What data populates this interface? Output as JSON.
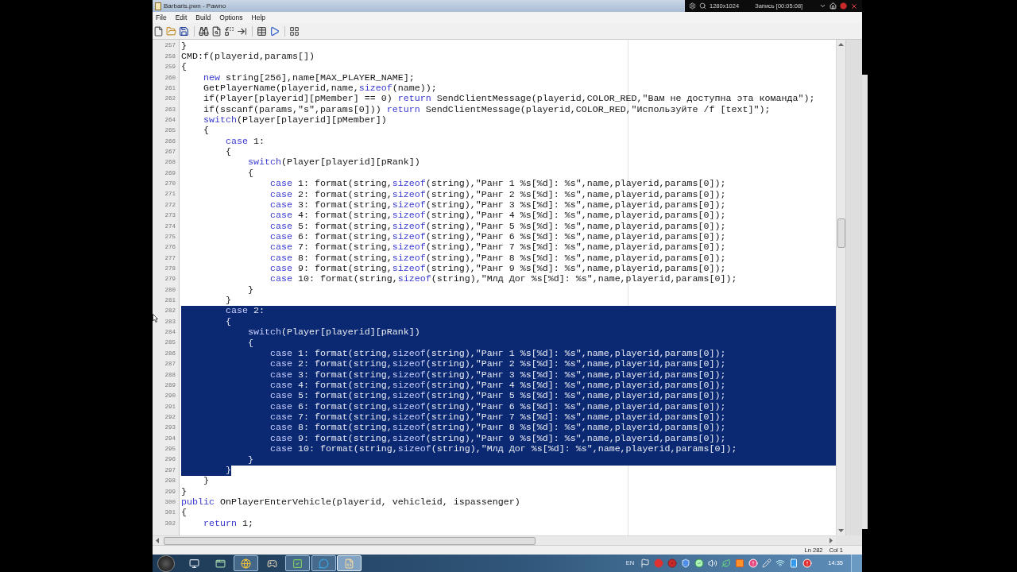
{
  "window": {
    "title": "Barbaris.pwn - Pawno"
  },
  "recorder_overlay": {
    "resolution": "1280x1024",
    "status": "Запись [00:05:08]"
  },
  "menu": [
    "File",
    "Edit",
    "Build",
    "Options",
    "Help"
  ],
  "editor": {
    "lines": [
      {
        "number": "257",
        "selected": false,
        "segments": [
          {
            "text": "}",
            "kind": "plain"
          }
        ]
      },
      {
        "number": "258",
        "selected": false,
        "segments": [
          {
            "text": "CMD:f(playerid,params[])",
            "kind": "plain"
          }
        ]
      },
      {
        "number": "259",
        "selected": false,
        "segments": [
          {
            "text": "{",
            "kind": "plain"
          }
        ]
      },
      {
        "number": "260",
        "selected": false,
        "segments": [
          {
            "text": "    new",
            "kind": "keyword"
          },
          {
            "text": " string[256],name[MAX_PLAYER_NAME];",
            "kind": "plain"
          }
        ]
      },
      {
        "number": "261",
        "selected": false,
        "segments": [
          {
            "text": "    GetPlayerName(playerid,name,",
            "kind": "plain"
          },
          {
            "text": "sizeof",
            "kind": "keyword"
          },
          {
            "text": "(name));",
            "kind": "plain"
          }
        ]
      },
      {
        "number": "262",
        "selected": false,
        "segments": [
          {
            "text": "    if(Player[playerid][pMember] == 0) ",
            "kind": "plain"
          },
          {
            "text": "return",
            "kind": "keyword"
          },
          {
            "text": " SendClientMessage(playerid,COLOR_RED,\"Вам не доступна эта команда\");",
            "kind": "plain"
          }
        ]
      },
      {
        "number": "263",
        "selected": false,
        "segments": [
          {
            "text": "    if(sscanf(params,\"s\",params[0])) ",
            "kind": "plain"
          },
          {
            "text": "return",
            "kind": "keyword"
          },
          {
            "text": " SendClientMessage(playerid,COLOR_RED,\"Используйте /f [text]\");",
            "kind": "plain"
          }
        ]
      },
      {
        "number": "264",
        "selected": false,
        "segments": [
          {
            "text": "    switch",
            "kind": "keyword"
          },
          {
            "text": "(Player[playerid][pMember])",
            "kind": "plain"
          }
        ]
      },
      {
        "number": "265",
        "selected": false,
        "segments": [
          {
            "text": "    {",
            "kind": "plain"
          }
        ]
      },
      {
        "number": "266",
        "selected": false,
        "segments": [
          {
            "text": "        case",
            "kind": "keyword"
          },
          {
            "text": " 1:",
            "kind": "plain"
          }
        ]
      },
      {
        "number": "267",
        "selected": false,
        "segments": [
          {
            "text": "        {",
            "kind": "plain"
          }
        ]
      },
      {
        "number": "268",
        "selected": false,
        "segments": [
          {
            "text": "            switch",
            "kind": "keyword"
          },
          {
            "text": "(Player[playerid][pRank])",
            "kind": "plain"
          }
        ]
      },
      {
        "number": "269",
        "selected": false,
        "segments": [
          {
            "text": "            {",
            "kind": "plain"
          }
        ]
      },
      {
        "number": "270",
        "selected": false,
        "segments": [
          {
            "text": "                case",
            "kind": "keyword"
          },
          {
            "text": " 1: format(string,",
            "kind": "plain"
          },
          {
            "text": "sizeof",
            "kind": "keyword"
          },
          {
            "text": "(string),\"Ранг 1 %s[%d]: %s\",name,playerid,params[0]);",
            "kind": "plain"
          }
        ]
      },
      {
        "number": "271",
        "selected": false,
        "segments": [
          {
            "text": "                case",
            "kind": "keyword"
          },
          {
            "text": " 2: format(string,",
            "kind": "plain"
          },
          {
            "text": "sizeof",
            "kind": "keyword"
          },
          {
            "text": "(string),\"Ранг 2 %s[%d]: %s\",name,playerid,params[0]);",
            "kind": "plain"
          }
        ]
      },
      {
        "number": "272",
        "selected": false,
        "segments": [
          {
            "text": "                case",
            "kind": "keyword"
          },
          {
            "text": " 3: format(string,",
            "kind": "plain"
          },
          {
            "text": "sizeof",
            "kind": "keyword"
          },
          {
            "text": "(string),\"Ранг 3 %s[%d]: %s\",name,playerid,params[0]);",
            "kind": "plain"
          }
        ]
      },
      {
        "number": "273",
        "selected": false,
        "segments": [
          {
            "text": "                case",
            "kind": "keyword"
          },
          {
            "text": " 4: format(string,",
            "kind": "plain"
          },
          {
            "text": "sizeof",
            "kind": "keyword"
          },
          {
            "text": "(string),\"Ранг 4 %s[%d]: %s\",name,playerid,params[0]);",
            "kind": "plain"
          }
        ]
      },
      {
        "number": "274",
        "selected": false,
        "segments": [
          {
            "text": "                case",
            "kind": "keyword"
          },
          {
            "text": " 5: format(string,",
            "kind": "plain"
          },
          {
            "text": "sizeof",
            "kind": "keyword"
          },
          {
            "text": "(string),\"Ранг 5 %s[%d]: %s\",name,playerid,params[0]);",
            "kind": "plain"
          }
        ]
      },
      {
        "number": "275",
        "selected": false,
        "segments": [
          {
            "text": "                case",
            "kind": "keyword"
          },
          {
            "text": " 6: format(string,",
            "kind": "plain"
          },
          {
            "text": "sizeof",
            "kind": "keyword"
          },
          {
            "text": "(string),\"Ранг 6 %s[%d]: %s\",name,playerid,params[0]);",
            "kind": "plain"
          }
        ]
      },
      {
        "number": "276",
        "selected": false,
        "segments": [
          {
            "text": "                case",
            "kind": "keyword"
          },
          {
            "text": " 7: format(string,",
            "kind": "plain"
          },
          {
            "text": "sizeof",
            "kind": "keyword"
          },
          {
            "text": "(string),\"Ранг 7 %s[%d]: %s\",name,playerid,params[0]);",
            "kind": "plain"
          }
        ]
      },
      {
        "number": "277",
        "selected": false,
        "segments": [
          {
            "text": "                case",
            "kind": "keyword"
          },
          {
            "text": " 8: format(string,",
            "kind": "plain"
          },
          {
            "text": "sizeof",
            "kind": "keyword"
          },
          {
            "text": "(string),\"Ранг 8 %s[%d]: %s\",name,playerid,params[0]);",
            "kind": "plain"
          }
        ]
      },
      {
        "number": "278",
        "selected": false,
        "segments": [
          {
            "text": "                case",
            "kind": "keyword"
          },
          {
            "text": " 9: format(string,",
            "kind": "plain"
          },
          {
            "text": "sizeof",
            "kind": "keyword"
          },
          {
            "text": "(string),\"Ранг 9 %s[%d]: %s\",name,playerid,params[0]);",
            "kind": "plain"
          }
        ]
      },
      {
        "number": "279",
        "selected": false,
        "segments": [
          {
            "text": "                case",
            "kind": "keyword"
          },
          {
            "text": " 10: format(string,",
            "kind": "plain"
          },
          {
            "text": "sizeof",
            "kind": "keyword"
          },
          {
            "text": "(string),\"Млд Дог %s[%d]: %s\",name,playerid,params[0]);",
            "kind": "plain"
          }
        ]
      },
      {
        "number": "280",
        "selected": false,
        "segments": [
          {
            "text": "            }",
            "kind": "plain"
          }
        ]
      },
      {
        "number": "281",
        "selected": false,
        "segments": [
          {
            "text": "        }",
            "kind": "plain"
          }
        ]
      },
      {
        "number": "282",
        "selected": true,
        "segments": [
          {
            "text": "        case",
            "kind": "keyword"
          },
          {
            "text": " 2:",
            "kind": "plain"
          }
        ]
      },
      {
        "number": "283",
        "selected": true,
        "segments": [
          {
            "text": "        {",
            "kind": "plain"
          }
        ]
      },
      {
        "number": "284",
        "selected": true,
        "segments": [
          {
            "text": "            switch",
            "kind": "keyword"
          },
          {
            "text": "(Player[playerid][pRank])",
            "kind": "plain"
          }
        ]
      },
      {
        "number": "285",
        "selected": true,
        "segments": [
          {
            "text": "            {",
            "kind": "plain"
          }
        ]
      },
      {
        "number": "286",
        "selected": true,
        "segments": [
          {
            "text": "                case",
            "kind": "keyword"
          },
          {
            "text": " 1: format(string,",
            "kind": "plain"
          },
          {
            "text": "sizeof",
            "kind": "keyword"
          },
          {
            "text": "(string),\"Ранг 1 %s[%d]: %s\",name,playerid,params[0]);",
            "kind": "plain"
          }
        ]
      },
      {
        "number": "287",
        "selected": true,
        "segments": [
          {
            "text": "                case",
            "kind": "keyword"
          },
          {
            "text": " 2: format(string,",
            "kind": "plain"
          },
          {
            "text": "sizeof",
            "kind": "keyword"
          },
          {
            "text": "(string),\"Ранг 2 %s[%d]: %s\",name,playerid,params[0]);",
            "kind": "plain"
          }
        ]
      },
      {
        "number": "288",
        "selected": true,
        "segments": [
          {
            "text": "                case",
            "kind": "keyword"
          },
          {
            "text": " 3: format(string,",
            "kind": "plain"
          },
          {
            "text": "sizeof",
            "kind": "keyword"
          },
          {
            "text": "(string),\"Ранг 3 %s[%d]: %s\",name,playerid,params[0]);",
            "kind": "plain"
          }
        ]
      },
      {
        "number": "289",
        "selected": true,
        "segments": [
          {
            "text": "                case",
            "kind": "keyword"
          },
          {
            "text": " 4: format(string,",
            "kind": "plain"
          },
          {
            "text": "sizeof",
            "kind": "keyword"
          },
          {
            "text": "(string),\"Ранг 4 %s[%d]: %s\",name,playerid,params[0]);",
            "kind": "plain"
          }
        ]
      },
      {
        "number": "290",
        "selected": true,
        "segments": [
          {
            "text": "                case",
            "kind": "keyword"
          },
          {
            "text": " 5: format(string,",
            "kind": "plain"
          },
          {
            "text": "sizeof",
            "kind": "keyword"
          },
          {
            "text": "(string),\"Ранг 5 %s[%d]: %s\",name,playerid,params[0]);",
            "kind": "plain"
          }
        ]
      },
      {
        "number": "291",
        "selected": true,
        "segments": [
          {
            "text": "                case",
            "kind": "keyword"
          },
          {
            "text": " 6: format(string,",
            "kind": "plain"
          },
          {
            "text": "sizeof",
            "kind": "keyword"
          },
          {
            "text": "(string),\"Ранг 6 %s[%d]: %s\",name,playerid,params[0]);",
            "kind": "plain"
          }
        ]
      },
      {
        "number": "292",
        "selected": true,
        "segments": [
          {
            "text": "                case",
            "kind": "keyword"
          },
          {
            "text": " 7: format(string,",
            "kind": "plain"
          },
          {
            "text": "sizeof",
            "kind": "keyword"
          },
          {
            "text": "(string),\"Ранг 7 %s[%d]: %s\",name,playerid,params[0]);",
            "kind": "plain"
          }
        ]
      },
      {
        "number": "293",
        "selected": true,
        "segments": [
          {
            "text": "                case",
            "kind": "keyword"
          },
          {
            "text": " 8: format(string,",
            "kind": "plain"
          },
          {
            "text": "sizeof",
            "kind": "keyword"
          },
          {
            "text": "(string),\"Ранг 8 %s[%d]: %s\",name,playerid,params[0]);",
            "kind": "plain"
          }
        ]
      },
      {
        "number": "294",
        "selected": true,
        "segments": [
          {
            "text": "                case",
            "kind": "keyword"
          },
          {
            "text": " 9: format(string,",
            "kind": "plain"
          },
          {
            "text": "sizeof",
            "kind": "keyword"
          },
          {
            "text": "(string),\"Ранг 9 %s[%d]: %s\",name,playerid,params[0]);",
            "kind": "plain"
          }
        ]
      },
      {
        "number": "295",
        "selected": true,
        "segments": [
          {
            "text": "                case",
            "kind": "keyword"
          },
          {
            "text": " 10: format(string,",
            "kind": "plain"
          },
          {
            "text": "sizeof",
            "kind": "keyword"
          },
          {
            "text": "(string),\"Млд Дог %s[%d]: %s\",name,playerid,params[0]);",
            "kind": "plain"
          }
        ]
      },
      {
        "number": "296",
        "selected": true,
        "segments": [
          {
            "text": "            }",
            "kind": "plain"
          }
        ]
      },
      {
        "number": "297",
        "selected": true,
        "segments": [
          {
            "text": "        }",
            "kind": "plain"
          }
        ]
      },
      {
        "number": "298",
        "selected": false,
        "segments": [
          {
            "text": "    }",
            "kind": "plain"
          }
        ]
      },
      {
        "number": "299",
        "selected": false,
        "segments": [
          {
            "text": "}",
            "kind": "plain"
          }
        ]
      },
      {
        "number": "300",
        "selected": false,
        "segments": [
          {
            "text": "public",
            "kind": "keyword"
          },
          {
            "text": " OnPlayerEnterVehicle(playerid, vehicleid, ispassenger)",
            "kind": "plain"
          }
        ]
      },
      {
        "number": "301",
        "selected": false,
        "segments": [
          {
            "text": "{",
            "kind": "plain"
          }
        ]
      },
      {
        "number": "302",
        "selected": false,
        "segments": [
          {
            "text": "    return",
            "kind": "keyword"
          },
          {
            "text": " 1;",
            "kind": "plain"
          }
        ]
      }
    ]
  },
  "status_bar": {
    "line": "Ln 282",
    "column": "Col 1"
  },
  "taskbar": {
    "apps": [
      {
        "running": false,
        "selected": false
      },
      {
        "running": false,
        "selected": false
      },
      {
        "running": true,
        "selected": false
      },
      {
        "running": false,
        "selected": false
      },
      {
        "running": true,
        "selected": false
      },
      {
        "running": true,
        "selected": false
      },
      {
        "running": true,
        "selected": true
      }
    ],
    "language": "EN",
    "clock": "14:35"
  }
}
